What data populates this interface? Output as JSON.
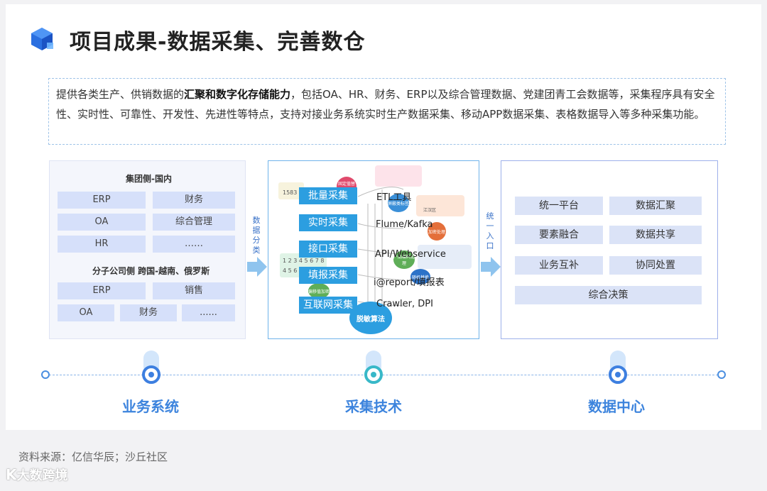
{
  "header": {
    "title": "项目成果-数据采集、完善数仓"
  },
  "description": {
    "prefix": "提供各类生产、供销数据的",
    "bold": "汇聚和数字化存储能力",
    "suffix": "，包括OA、HR、财务、ERP以及综合管理数据、党建团青工会数据等，采集程序具有安全性、实时性、可靠性、开发性、先进性等特点，支持对接业务系统实时生产数据采集、移动APP数据采集、表格数据导入等多种采集功能。"
  },
  "business": {
    "group_title": "集团侧-国内",
    "group_items": [
      "ERP",
      "财务",
      "OA",
      "综合管理",
      "HR",
      "……"
    ],
    "sub_title": "分子公司侧  跨国-越南、俄罗斯",
    "sub_items": [
      "ERP",
      "销售",
      "OA",
      "财务",
      "......"
    ]
  },
  "arrow_labels": {
    "left": "数据分类",
    "right": "统一入口"
  },
  "collection": {
    "methods": [
      "批量采集",
      "实时采集",
      "接口采集",
      "填报采集",
      "互联网采集"
    ],
    "techs": [
      "ETL工具",
      "Flume/Kafka",
      "API/Webservice",
      "i@report/填报表",
      "Crawler, DPI"
    ],
    "center": "脱敏算法",
    "small_labels": [
      "固定值替换",
      "屏蔽类标签",
      "加密处理",
      "偏移值加密",
      "产品编码处理",
      "随机替换",
      "江汉区"
    ],
    "number_tags": [
      "1583",
      "1 2 3 4 5 6 7 8",
      "4 5 6"
    ]
  },
  "data_center": {
    "items": [
      "统一平台",
      "数据汇聚",
      "要素融合",
      "数据共享",
      "业务互补",
      "协同处置",
      "综合决策"
    ]
  },
  "stages": [
    "业务系统",
    "采集技术",
    "数据中心"
  ],
  "footer": {
    "source": "资料来源：亿信华辰；沙丘社区",
    "watermark": "大数跨境"
  },
  "colors": {
    "accent": "#3d84dd",
    "method_bg": "#2c9ee0",
    "chip_bg": "#d6e0fa"
  }
}
